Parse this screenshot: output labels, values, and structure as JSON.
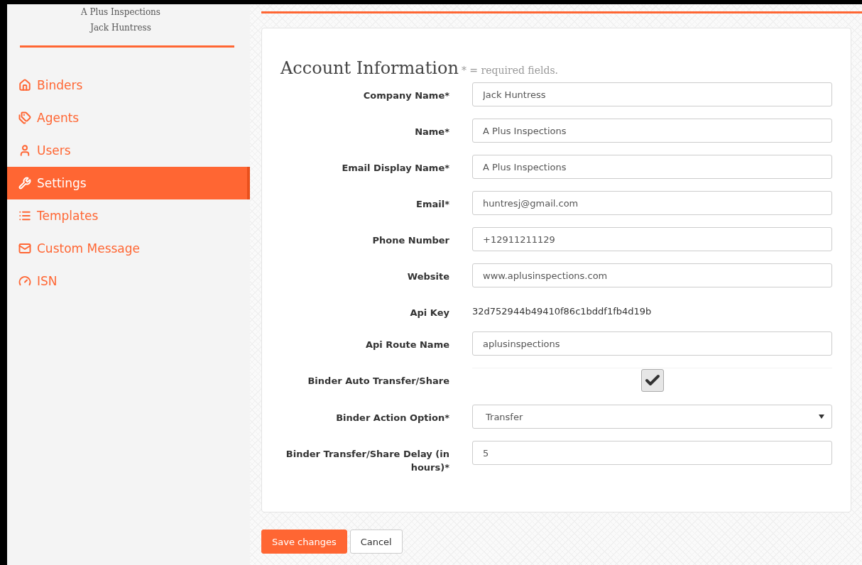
{
  "sidebar": {
    "company": "A Plus Inspections",
    "user": "Jack Huntress",
    "items": [
      {
        "label": "Binders",
        "selected": false
      },
      {
        "label": "Agents",
        "selected": false
      },
      {
        "label": "Users",
        "selected": false
      },
      {
        "label": "Settings",
        "selected": true
      },
      {
        "label": "Templates",
        "selected": false
      },
      {
        "label": "Custom Message",
        "selected": false
      },
      {
        "label": "ISN",
        "selected": false
      }
    ]
  },
  "form": {
    "title": "Account Information",
    "note": "* = required fields.",
    "fields": [
      {
        "kind": "text",
        "label": "Company Name*",
        "value": "Jack Huntress"
      },
      {
        "kind": "text",
        "label": "Name*",
        "value": "A Plus Inspections"
      },
      {
        "kind": "text",
        "label": "Email Display Name*",
        "value": "A Plus Inspections"
      },
      {
        "kind": "text",
        "label": "Email*",
        "value": "huntresj@gmail.com"
      },
      {
        "kind": "text",
        "label": "Phone Number",
        "value": "+12911211129"
      },
      {
        "kind": "text",
        "label": "Website",
        "value": "www.aplusinspections.com"
      },
      {
        "kind": "static",
        "label": "Api Key",
        "value": "32d752944b49410f86c1bddf1fb4d19b"
      },
      {
        "kind": "text",
        "label": "Api Route Name",
        "value": "aplusinspections"
      },
      {
        "kind": "checkbox",
        "label": "Binder Auto Transfer/Share",
        "checked": true
      },
      {
        "kind": "select",
        "label": "Binder Action Option*",
        "value": "Transfer"
      },
      {
        "kind": "text",
        "label": "Binder Transfer/Share Delay (in hours)*",
        "value": "5"
      }
    ]
  },
  "buttons": {
    "save": "Save changes",
    "cancel": "Cancel"
  }
}
